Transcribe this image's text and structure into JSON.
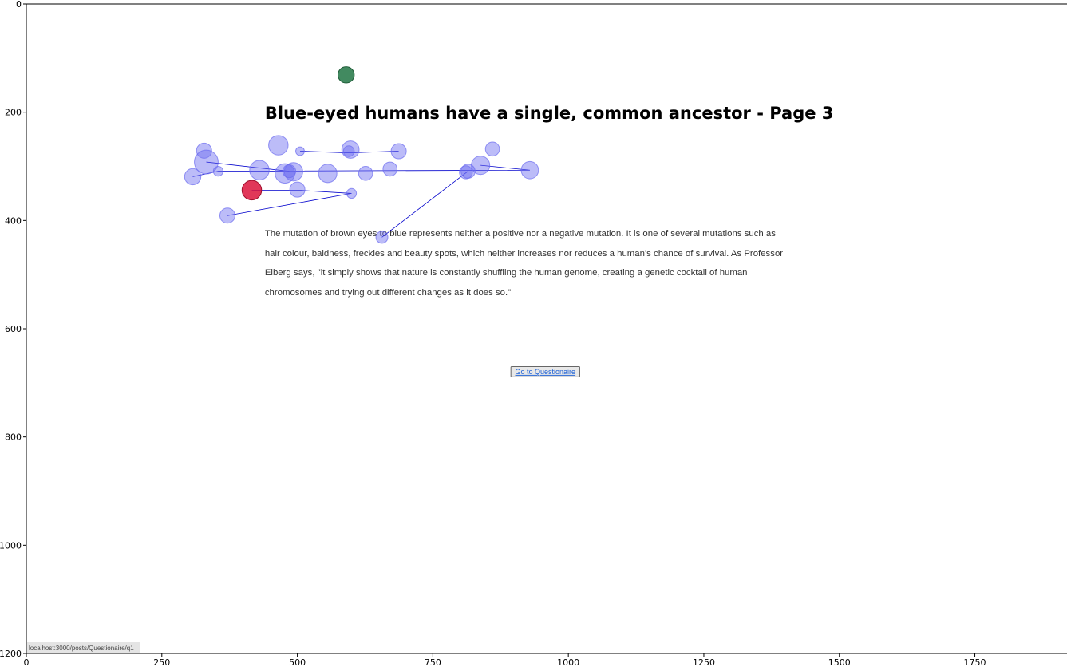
{
  "chart_data": {
    "type": "scatter",
    "xlim": [
      0,
      1920
    ],
    "ylim": [
      1200,
      0
    ],
    "x_ticks": [
      0,
      250,
      500,
      750,
      1000,
      1250,
      1500,
      1750
    ],
    "y_ticks": [
      0,
      200,
      400,
      600,
      800,
      1000,
      1200
    ],
    "grid": false,
    "page": {
      "title": "Blue-eyed humans have a single, common ancestor - Page 3",
      "title_pos": [
        440,
        202
      ],
      "paragraph_lines": [
        "The mutation of brown eyes to blue represents neither a positive nor a negative mutation. It is one of several mutations such as",
        "hair colour, baldness, freckles and beauty spots, which neither increases nor reduces a human's chance of survival. As Professor",
        "Eiberg says, \"it simply shows that nature is constantly shuffling the human genome, creating a genetic cocktail of human",
        "chromosomes and trying out different changes as it does so.\""
      ],
      "paragraph_x": 440,
      "paragraph_line_y": [
        423,
        460,
        495,
        532
      ],
      "button_label": "Go to Questionaire",
      "button_box": [
        894,
        670,
        1021,
        689
      ],
      "status_url": "localhost:3000/posts/Questionaire/q1"
    },
    "start_point": {
      "x": 590,
      "y": 131,
      "r": 15,
      "color": "#2e7d4f"
    },
    "end_point": {
      "x": 416,
      "y": 344,
      "r": 18,
      "color": "#dc143c"
    },
    "fixation_color": "#6b6bf0",
    "path_color": "#0000cc",
    "fixations": [
      {
        "x": 328,
        "y": 271,
        "r": 14
      },
      {
        "x": 332,
        "y": 292,
        "r": 22
      },
      {
        "x": 307,
        "y": 319,
        "r": 15
      },
      {
        "x": 354,
        "y": 309,
        "r": 9
      },
      {
        "x": 430,
        "y": 307,
        "r": 18
      },
      {
        "x": 465,
        "y": 261,
        "r": 18
      },
      {
        "x": 477,
        "y": 313,
        "r": 18
      },
      {
        "x": 485,
        "y": 309,
        "r": 12
      },
      {
        "x": 493,
        "y": 310,
        "r": 17
      },
      {
        "x": 500,
        "y": 343,
        "r": 14
      },
      {
        "x": 505,
        "y": 272,
        "r": 8
      },
      {
        "x": 556,
        "y": 313,
        "r": 17
      },
      {
        "x": 595,
        "y": 272,
        "r": 10
      },
      {
        "x": 598,
        "y": 269,
        "r": 16
      },
      {
        "x": 600,
        "y": 350,
        "r": 9
      },
      {
        "x": 626,
        "y": 313,
        "r": 13
      },
      {
        "x": 671,
        "y": 305,
        "r": 13
      },
      {
        "x": 687,
        "y": 272,
        "r": 14
      },
      {
        "x": 656,
        "y": 431,
        "r": 11
      },
      {
        "x": 811,
        "y": 311,
        "r": 12
      },
      {
        "x": 815,
        "y": 309,
        "r": 13
      },
      {
        "x": 838,
        "y": 298,
        "r": 17
      },
      {
        "x": 860,
        "y": 268,
        "r": 13
      },
      {
        "x": 929,
        "y": 307,
        "r": 16
      },
      {
        "x": 371,
        "y": 391,
        "r": 14
      }
    ],
    "path": [
      [
        416,
        344
      ],
      [
        500,
        344
      ],
      [
        600,
        350
      ],
      [
        371,
        391
      ]
    ],
    "path_extra": [
      [
        [
          505,
          272
        ],
        [
          595,
          275
        ],
        [
          687,
          272
        ]
      ],
      [
        [
          307,
          319
        ],
        [
          354,
          309
        ],
        [
          929,
          307
        ],
        [
          838,
          298
        ]
      ],
      [
        [
          332,
          292
        ],
        [
          485,
          309
        ]
      ],
      [
        [
          815,
          309
        ],
        [
          656,
          431
        ]
      ]
    ]
  }
}
